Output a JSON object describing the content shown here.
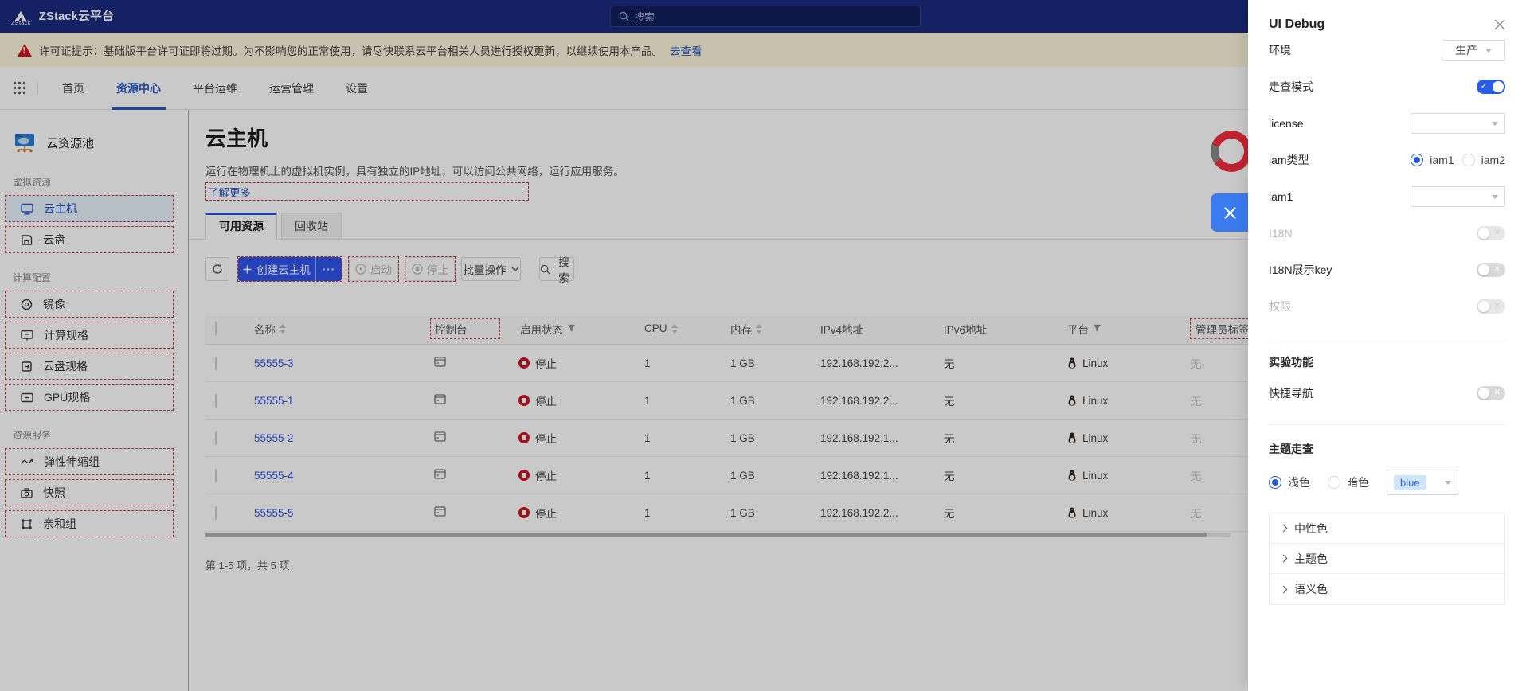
{
  "colors": {
    "brand_navy": "#1a2b80",
    "primary_blue": "#2f54eb",
    "accent_blue": "#2457d6",
    "debug_outline_red": "#d9363e",
    "status_stopped_red": "#cf1322",
    "banner_bg": "#fcf4dc"
  },
  "topbar": {
    "logo_text": "ZStack",
    "app_title": "ZStack云平台",
    "search_placeholder": "搜索"
  },
  "license_banner": {
    "text": "许可证提示：基础版平台许可证即将过期。为不影响您的正常使用，请尽快联系云平台相关人员进行授权更新，以继续使用本产品。",
    "link_label": "去查看"
  },
  "nav": {
    "tabs": [
      {
        "label": "首页"
      },
      {
        "label": "资源中心"
      },
      {
        "label": "平台运维"
      },
      {
        "label": "运营管理"
      },
      {
        "label": "设置"
      }
    ]
  },
  "sidebar": {
    "title": "云资源池",
    "sections": [
      {
        "label": "虚拟资源",
        "items": [
          {
            "label": "云主机"
          },
          {
            "label": "云盘"
          }
        ]
      },
      {
        "label": "计算配置",
        "items": [
          {
            "label": "镜像"
          },
          {
            "label": "计算规格"
          },
          {
            "label": "云盘规格"
          },
          {
            "label": "GPU规格"
          }
        ]
      },
      {
        "label": "资源服务",
        "items": [
          {
            "label": "弹性伸缩组"
          },
          {
            "label": "快照"
          },
          {
            "label": "亲和组"
          }
        ]
      }
    ]
  },
  "page": {
    "title": "云主机",
    "description": "运行在物理机上的虚拟机实例，具有独立的IP地址，可以访问公共网络，运行应用服务。",
    "learn_more": "了解更多",
    "tabs": [
      {
        "label": "可用资源"
      },
      {
        "label": "回收站"
      }
    ]
  },
  "toolbar": {
    "create_label": "创建云主机",
    "more_label": "···",
    "start_label": "启动",
    "stop_label": "停止",
    "batch_label": "批量操作",
    "search_label": "搜索"
  },
  "table": {
    "columns": {
      "name": "名称",
      "console": "控制台",
      "state": "启用状态",
      "cpu": "CPU",
      "memory": "内存",
      "ipv4": "IPv4地址",
      "ipv6": "IPv6地址",
      "platform": "平台",
      "admin_tag": "管理员标签"
    },
    "rows": [
      {
        "name": "55555-3",
        "state": "停止",
        "cpu": "1",
        "memory": "1 GB",
        "ipv4": "192.168.192.2...",
        "ipv6": "无",
        "platform": "Linux",
        "admin_tag": "无"
      },
      {
        "name": "55555-1",
        "state": "停止",
        "cpu": "1",
        "memory": "1 GB",
        "ipv4": "192.168.192.2...",
        "ipv6": "无",
        "platform": "Linux",
        "admin_tag": "无"
      },
      {
        "name": "55555-2",
        "state": "停止",
        "cpu": "1",
        "memory": "1 GB",
        "ipv4": "192.168.192.1...",
        "ipv6": "无",
        "platform": "Linux",
        "admin_tag": "无"
      },
      {
        "name": "55555-4",
        "state": "停止",
        "cpu": "1",
        "memory": "1 GB",
        "ipv4": "192.168.192.1...",
        "ipv6": "无",
        "platform": "Linux",
        "admin_tag": "无"
      },
      {
        "name": "55555-5",
        "state": "停止",
        "cpu": "1",
        "memory": "1 GB",
        "ipv4": "192.168.192.2...",
        "ipv6": "无",
        "platform": "Linux",
        "admin_tag": "无"
      }
    ],
    "footer": "第 1-5 项，共 5 项"
  },
  "debug_panel": {
    "title": "UI Debug",
    "env": {
      "label": "环境",
      "value": "生产"
    },
    "walkthrough": {
      "label": "走查模式",
      "on": true
    },
    "license": {
      "label": "license"
    },
    "iam_type": {
      "label": "iam类型",
      "options": [
        {
          "label": "iam1",
          "selected": true
        },
        {
          "label": "iam2",
          "selected": false
        }
      ]
    },
    "iam1": {
      "label": "iam1"
    },
    "i18n": {
      "label": "I18N",
      "disabled": true
    },
    "i18n_key": {
      "label": "I18N展示key"
    },
    "permission": {
      "label": "权限",
      "disabled": true
    },
    "experimental": {
      "title": "实验功能",
      "quick_nav": {
        "label": "快捷导航"
      }
    },
    "theme": {
      "title": "主题走查",
      "light_label": "浅色",
      "dark_label": "暗色",
      "color_value": "blue",
      "groups": [
        {
          "label": "中性色"
        },
        {
          "label": "主题色"
        },
        {
          "label": "语义色"
        }
      ]
    }
  }
}
